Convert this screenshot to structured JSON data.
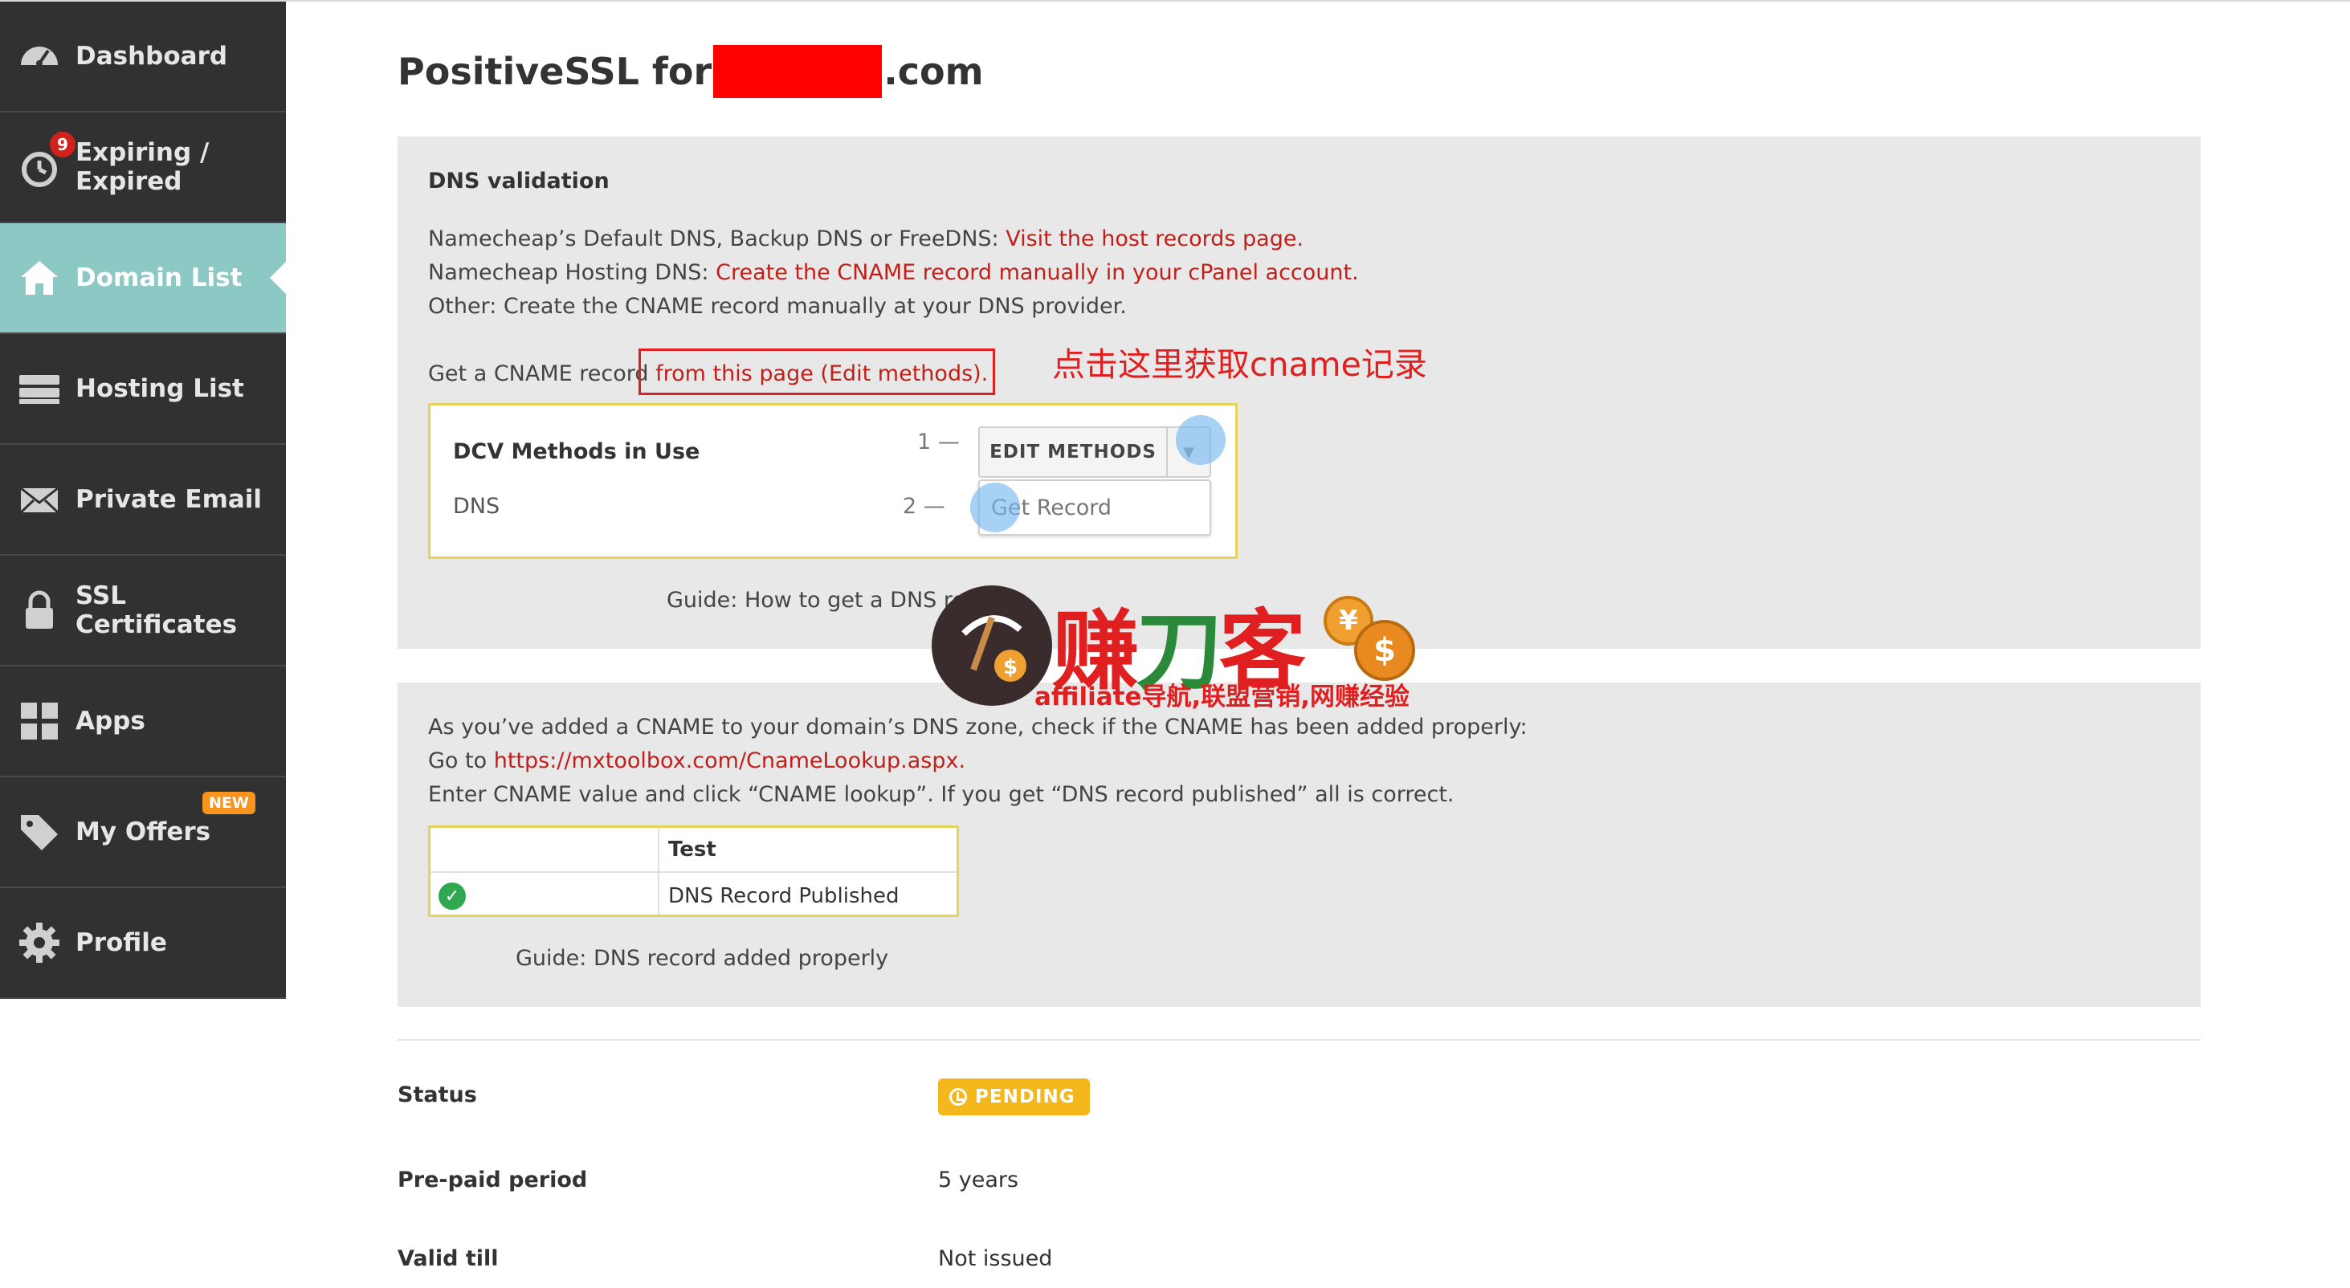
{
  "sidebar": {
    "items": [
      {
        "label": "Dashboard",
        "icon": "gauge-icon"
      },
      {
        "label": "Expiring / Expired",
        "icon": "alarm-clock-icon",
        "badge": "9"
      },
      {
        "label": "Domain List",
        "icon": "home-icon",
        "active": true
      },
      {
        "label": "Hosting List",
        "icon": "server-icon"
      },
      {
        "label": "Private Email",
        "icon": "envelope-icon"
      },
      {
        "label": "SSL Certificates",
        "icon": "lock-icon"
      },
      {
        "label": "Apps",
        "icon": "apps-grid-icon"
      },
      {
        "label": "My Offers",
        "icon": "tag-icon",
        "badge": "NEW"
      },
      {
        "label": "Profile",
        "icon": "gear-icon"
      }
    ],
    "active_color": "#8cc8c4",
    "bg_color": "#313131"
  },
  "header": {
    "title_prefix": "PositiveSSL for",
    "title_suffix": ".com"
  },
  "dns_panel": {
    "heading": "DNS validation",
    "line1_text": "Namecheap’s Default DNS, Backup DNS or FreeDNS: ",
    "line1_link": "Visit the host records page.",
    "line2_text": "Namecheap Hosting DNS: ",
    "line2_link": "Create the CNAME record manually in your cPanel account.",
    "line3_text": "Other: Create the CNAME record manually at your DNS provider.",
    "line4_text": "Get a CNAME record ",
    "line4_link": "from this page (Edit methods).",
    "annotation": "点击这里获取cname记录",
    "dcv": {
      "title": "DCV Methods in Use",
      "method": "DNS",
      "step1": "1 —",
      "step2": "2 —",
      "edit_button": "EDIT METHODS",
      "dropdown_item": "Get Record"
    },
    "guide": "Guide: How to get a DNS re"
  },
  "watermark": {
    "title_red1": "赚",
    "title_green": "刀",
    "title_red2": "客",
    "subtitle": "affiliate导航,联盟营销,网赚经验",
    "coin1": "¥",
    "coin2": "$"
  },
  "check_panel": {
    "line1": "As you’ve added a CNAME to your domain’s DNS zone, check if the CNAME has been added properly:",
    "line2_text": "Go to ",
    "line2_link": "https://mxtoolbox.com/CnameLookup.aspx.",
    "line3": "Enter CNAME value and click “CNAME lookup”. If you get “DNS record published” all is correct.",
    "table_header": "Test",
    "table_value": "DNS Record Published",
    "guide": "Guide: DNS record added properly"
  },
  "details": {
    "status_label": "Status",
    "status_value": "PENDING",
    "status_color": "#f5b81c",
    "prepaid_label": "Pre-paid period",
    "prepaid_value": "5 years",
    "valid_label": "Valid till",
    "valid_value": "Not issued"
  }
}
